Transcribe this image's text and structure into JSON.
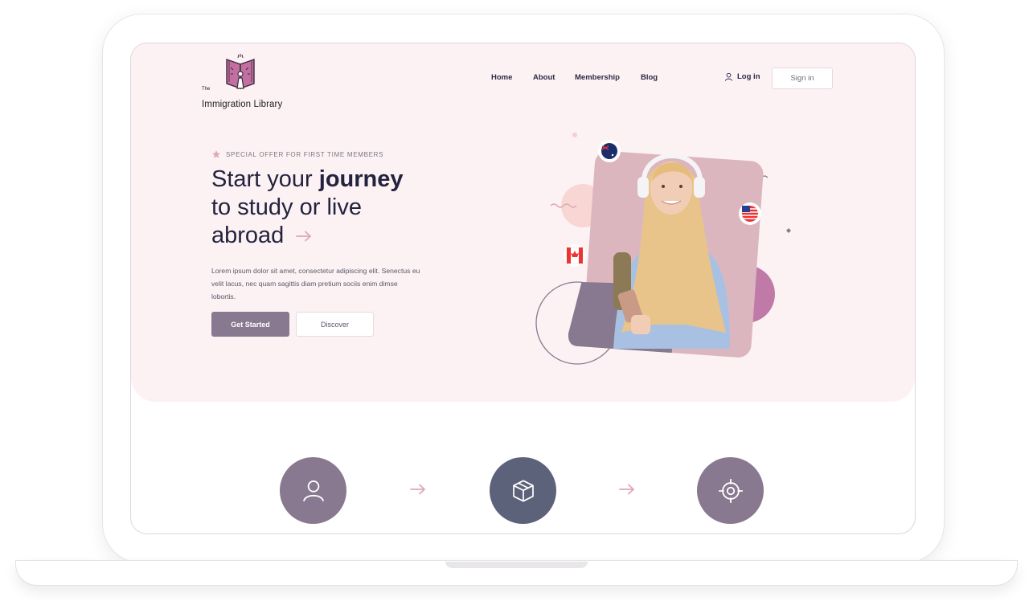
{
  "logo": {
    "line1": "The",
    "line2": "Immigration Library"
  },
  "nav": {
    "home": "Home",
    "about": "About",
    "membership": "Membership",
    "blog": "Blog"
  },
  "auth": {
    "login": "Log in",
    "signin": "Sign in"
  },
  "hero": {
    "offer": "SPECIAL OFFER FOR FIRST TIME MEMBERS",
    "headline_1": "Start your ",
    "headline_bold": "journey",
    "headline_2": "to study or live",
    "headline_3": "abroad",
    "description": "Lorem ipsum dolor sit amet, consectetur adipiscing elit. Senectus eu velit lacus, nec quam sagittis diam pretium sociis enim dimse lobortis.",
    "primary_button": "Get Started",
    "secondary_button": "Discover"
  },
  "colors": {
    "hero_bg": "#fcf2f3",
    "primary": "#887890",
    "navy": "#5c627a",
    "heading": "#23233f",
    "accent_pink": "#dfa7b4"
  },
  "steps": [
    {
      "icon": "user-icon",
      "color": "#887890"
    },
    {
      "icon": "box-icon",
      "color": "#5c627a"
    },
    {
      "icon": "target-icon",
      "color": "#887890"
    }
  ]
}
